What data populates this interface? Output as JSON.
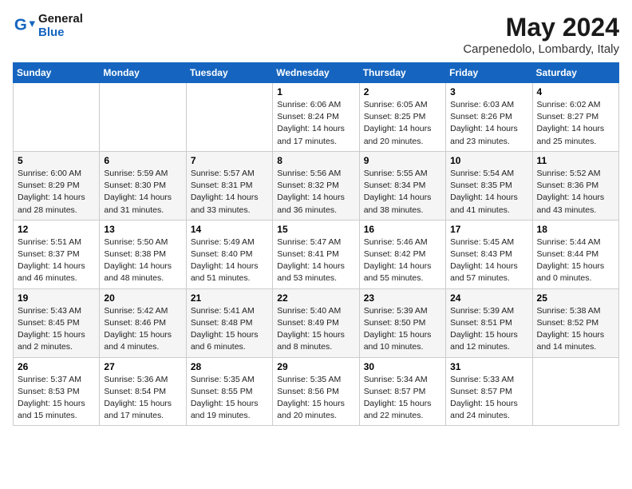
{
  "header": {
    "logo_line1": "General",
    "logo_line2": "Blue",
    "month_year": "May 2024",
    "location": "Carpenedolo, Lombardy, Italy"
  },
  "days_of_week": [
    "Sunday",
    "Monday",
    "Tuesday",
    "Wednesday",
    "Thursday",
    "Friday",
    "Saturday"
  ],
  "weeks": [
    [
      {
        "day": "",
        "info": ""
      },
      {
        "day": "",
        "info": ""
      },
      {
        "day": "",
        "info": ""
      },
      {
        "day": "1",
        "info": "Sunrise: 6:06 AM\nSunset: 8:24 PM\nDaylight: 14 hours\nand 17 minutes."
      },
      {
        "day": "2",
        "info": "Sunrise: 6:05 AM\nSunset: 8:25 PM\nDaylight: 14 hours\nand 20 minutes."
      },
      {
        "day": "3",
        "info": "Sunrise: 6:03 AM\nSunset: 8:26 PM\nDaylight: 14 hours\nand 23 minutes."
      },
      {
        "day": "4",
        "info": "Sunrise: 6:02 AM\nSunset: 8:27 PM\nDaylight: 14 hours\nand 25 minutes."
      }
    ],
    [
      {
        "day": "5",
        "info": "Sunrise: 6:00 AM\nSunset: 8:29 PM\nDaylight: 14 hours\nand 28 minutes."
      },
      {
        "day": "6",
        "info": "Sunrise: 5:59 AM\nSunset: 8:30 PM\nDaylight: 14 hours\nand 31 minutes."
      },
      {
        "day": "7",
        "info": "Sunrise: 5:57 AM\nSunset: 8:31 PM\nDaylight: 14 hours\nand 33 minutes."
      },
      {
        "day": "8",
        "info": "Sunrise: 5:56 AM\nSunset: 8:32 PM\nDaylight: 14 hours\nand 36 minutes."
      },
      {
        "day": "9",
        "info": "Sunrise: 5:55 AM\nSunset: 8:34 PM\nDaylight: 14 hours\nand 38 minutes."
      },
      {
        "day": "10",
        "info": "Sunrise: 5:54 AM\nSunset: 8:35 PM\nDaylight: 14 hours\nand 41 minutes."
      },
      {
        "day": "11",
        "info": "Sunrise: 5:52 AM\nSunset: 8:36 PM\nDaylight: 14 hours\nand 43 minutes."
      }
    ],
    [
      {
        "day": "12",
        "info": "Sunrise: 5:51 AM\nSunset: 8:37 PM\nDaylight: 14 hours\nand 46 minutes."
      },
      {
        "day": "13",
        "info": "Sunrise: 5:50 AM\nSunset: 8:38 PM\nDaylight: 14 hours\nand 48 minutes."
      },
      {
        "day": "14",
        "info": "Sunrise: 5:49 AM\nSunset: 8:40 PM\nDaylight: 14 hours\nand 51 minutes."
      },
      {
        "day": "15",
        "info": "Sunrise: 5:47 AM\nSunset: 8:41 PM\nDaylight: 14 hours\nand 53 minutes."
      },
      {
        "day": "16",
        "info": "Sunrise: 5:46 AM\nSunset: 8:42 PM\nDaylight: 14 hours\nand 55 minutes."
      },
      {
        "day": "17",
        "info": "Sunrise: 5:45 AM\nSunset: 8:43 PM\nDaylight: 14 hours\nand 57 minutes."
      },
      {
        "day": "18",
        "info": "Sunrise: 5:44 AM\nSunset: 8:44 PM\nDaylight: 15 hours\nand 0 minutes."
      }
    ],
    [
      {
        "day": "19",
        "info": "Sunrise: 5:43 AM\nSunset: 8:45 PM\nDaylight: 15 hours\nand 2 minutes."
      },
      {
        "day": "20",
        "info": "Sunrise: 5:42 AM\nSunset: 8:46 PM\nDaylight: 15 hours\nand 4 minutes."
      },
      {
        "day": "21",
        "info": "Sunrise: 5:41 AM\nSunset: 8:48 PM\nDaylight: 15 hours\nand 6 minutes."
      },
      {
        "day": "22",
        "info": "Sunrise: 5:40 AM\nSunset: 8:49 PM\nDaylight: 15 hours\nand 8 minutes."
      },
      {
        "day": "23",
        "info": "Sunrise: 5:39 AM\nSunset: 8:50 PM\nDaylight: 15 hours\nand 10 minutes."
      },
      {
        "day": "24",
        "info": "Sunrise: 5:39 AM\nSunset: 8:51 PM\nDaylight: 15 hours\nand 12 minutes."
      },
      {
        "day": "25",
        "info": "Sunrise: 5:38 AM\nSunset: 8:52 PM\nDaylight: 15 hours\nand 14 minutes."
      }
    ],
    [
      {
        "day": "26",
        "info": "Sunrise: 5:37 AM\nSunset: 8:53 PM\nDaylight: 15 hours\nand 15 minutes."
      },
      {
        "day": "27",
        "info": "Sunrise: 5:36 AM\nSunset: 8:54 PM\nDaylight: 15 hours\nand 17 minutes."
      },
      {
        "day": "28",
        "info": "Sunrise: 5:35 AM\nSunset: 8:55 PM\nDaylight: 15 hours\nand 19 minutes."
      },
      {
        "day": "29",
        "info": "Sunrise: 5:35 AM\nSunset: 8:56 PM\nDaylight: 15 hours\nand 20 minutes."
      },
      {
        "day": "30",
        "info": "Sunrise: 5:34 AM\nSunset: 8:57 PM\nDaylight: 15 hours\nand 22 minutes."
      },
      {
        "day": "31",
        "info": "Sunrise: 5:33 AM\nSunset: 8:57 PM\nDaylight: 15 hours\nand 24 minutes."
      },
      {
        "day": "",
        "info": ""
      }
    ]
  ]
}
